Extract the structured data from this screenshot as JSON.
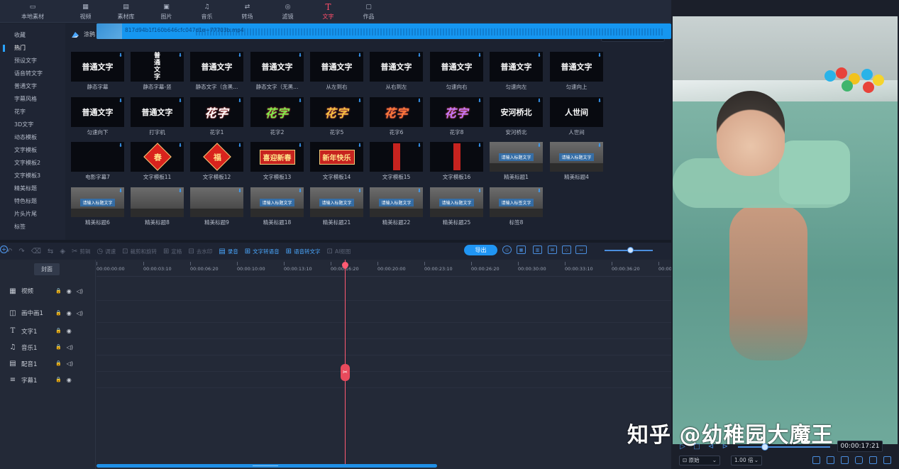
{
  "nav": {
    "tabs": [
      {
        "label": "本地素材",
        "icon": "folder-icon"
      },
      {
        "label": "视频",
        "icon": "film-icon"
      },
      {
        "label": "素材库",
        "icon": "library-icon"
      },
      {
        "label": "图片",
        "icon": "image-icon"
      },
      {
        "label": "音乐",
        "icon": "music-icon"
      },
      {
        "label": "转场",
        "icon": "transition-icon"
      },
      {
        "label": "滤镜",
        "icon": "filter-icon"
      },
      {
        "label": "文字",
        "icon": "text-icon"
      },
      {
        "label": "作品",
        "icon": "works-icon"
      }
    ],
    "active_index": 7
  },
  "sidebar": {
    "items": [
      "收藏",
      "热门",
      "预设文字",
      "语音转文字",
      "普通文字",
      "字幕风格",
      "花字",
      "3D文字",
      "动态模板",
      "文字模板",
      "文字模板2",
      "文字模板3",
      "精美标题",
      "特色标题",
      "片头片尾",
      "标签"
    ],
    "active_index": 1
  },
  "library": {
    "category": "涂鸦",
    "search_placeholder": "搜索",
    "tiles": [
      {
        "label": "静态字幕",
        "preview": "普通文字"
      },
      {
        "label": "静态字幕-竖",
        "preview": "普通文字"
      },
      {
        "label": "静态文字（含黑...",
        "preview": "普通文字"
      },
      {
        "label": "静态文字（无黑...",
        "preview": "普通文字"
      },
      {
        "label": "从左到右",
        "preview": "普通文字"
      },
      {
        "label": "从右到左",
        "preview": "普通文字"
      },
      {
        "label": "匀速向右",
        "preview": "普通文字"
      },
      {
        "label": "匀速向左",
        "preview": "普通文字"
      },
      {
        "label": "匀速向上",
        "preview": "普通文字"
      },
      {
        "label": "匀速向下",
        "preview": "普通文字"
      },
      {
        "label": "打字机",
        "preview": "普通文字"
      },
      {
        "label": "花字1",
        "preview": "花字"
      },
      {
        "label": "花字2",
        "preview": "花字"
      },
      {
        "label": "花字5",
        "preview": "花字"
      },
      {
        "label": "花字6",
        "preview": "花字"
      },
      {
        "label": "花字8",
        "preview": "花字"
      },
      {
        "label": "安河桥北",
        "preview": "安河桥北"
      },
      {
        "label": "人世间",
        "preview": "人世间"
      },
      {
        "label": "电影字幕7",
        "preview": ""
      },
      {
        "label": "文字模板11",
        "preview": "春"
      },
      {
        "label": "文字模板12",
        "preview": "福"
      },
      {
        "label": "文字模板13",
        "preview": "喜迎新春"
      },
      {
        "label": "文字模板14",
        "preview": "新年快乐"
      },
      {
        "label": "文字模板15",
        "preview": ""
      },
      {
        "label": "文字模板16",
        "preview": ""
      },
      {
        "label": "精美标题1",
        "preview": "请输入标题文字"
      },
      {
        "label": "精美标题4",
        "preview": "请输入标题文字"
      },
      {
        "label": "精美标题6",
        "preview": "请输入标题文字"
      },
      {
        "label": "精美标题8",
        "preview": ""
      },
      {
        "label": "精美标题9",
        "preview": ""
      },
      {
        "label": "精美标题18",
        "preview": "请输入标题文字"
      },
      {
        "label": "精美标题21",
        "preview": "请输入标题文字"
      },
      {
        "label": "精美标题22",
        "preview": "请输入标题文字"
      },
      {
        "label": "精美标题25",
        "preview": "请输入标题文字"
      },
      {
        "label": "标签8",
        "preview": "请输入标签文字"
      }
    ]
  },
  "toolbar": {
    "items": [
      {
        "label": "",
        "icon": "undo-icon",
        "on": false
      },
      {
        "label": "",
        "icon": "redo-icon",
        "on": false
      },
      {
        "label": "",
        "icon": "delete-icon",
        "on": false
      },
      {
        "label": "",
        "icon": "split-icon",
        "on": false
      },
      {
        "label": "",
        "icon": "marker-icon",
        "on": false
      },
      {
        "label": "剪辑",
        "icon": "scissors-icon",
        "on": false
      },
      {
        "label": "调速",
        "icon": "speed-icon",
        "on": false
      },
      {
        "label": "裁剪和旋转",
        "icon": "crop-icon",
        "on": false
      },
      {
        "label": "定格",
        "icon": "freeze-icon",
        "on": false
      },
      {
        "label": "去水印",
        "icon": "watermark-icon",
        "on": false
      },
      {
        "label": "录音",
        "icon": "mic-icon",
        "on": true
      },
      {
        "label": "文字转语音",
        "icon": "tts-icon",
        "on": true
      },
      {
        "label": "语音转文字",
        "icon": "stt-icon",
        "on": true
      },
      {
        "label": "AI抠图",
        "icon": "ai-icon",
        "on": false
      }
    ],
    "export_label": "导出"
  },
  "timeline": {
    "cover_label": "封面",
    "ruler": [
      "00:00:00:00",
      "00:00:03:10",
      "00:00:06:20",
      "00:00:10:00",
      "00:00:13:10",
      "00:00:16:20",
      "00:00:20:00",
      "00:00:23:10",
      "00:00:26:20",
      "00:00:30:00",
      "00:00:33:10",
      "00:00:36:20",
      "00:00"
    ],
    "tracks": [
      {
        "label": "视频",
        "icon": "film-icon"
      },
      {
        "label": "画中画1",
        "icon": "pip-icon"
      },
      {
        "label": "文字1",
        "icon": "text-icon"
      },
      {
        "label": "音乐1",
        "icon": "music-icon"
      },
      {
        "label": "配音1",
        "icon": "mic-icon"
      },
      {
        "label": "字幕1",
        "icon": "subtitle-icon"
      }
    ],
    "clip_name": "817d94b1f160b646cfc047d1e~77703b.mp4"
  },
  "player": {
    "watermark": "知乎 @幼稚园大魔王",
    "current_time": "00:00:17:21",
    "ratio_label": "原始",
    "speed_label": "1.00 倍"
  },
  "colors": {
    "accent": "#2095f3",
    "active_tab": "#ff4e6a",
    "playhead": "#ff5a72"
  }
}
